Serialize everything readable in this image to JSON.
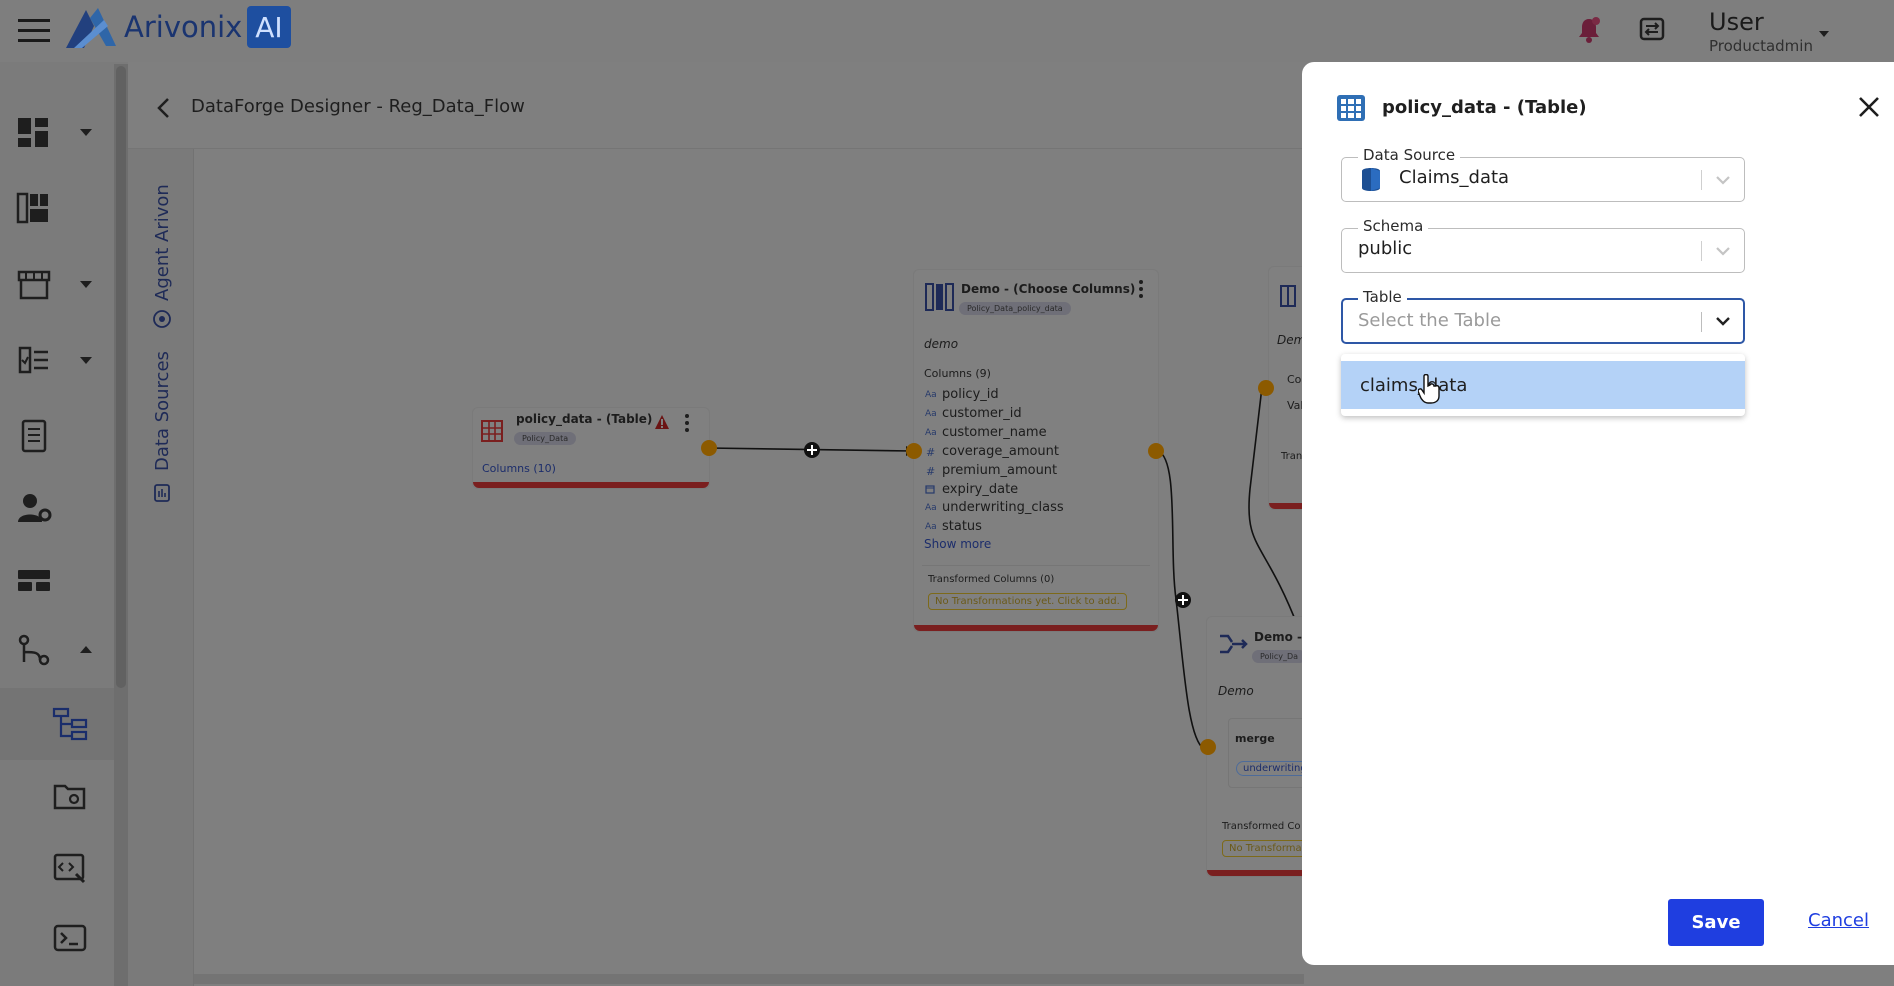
{
  "app": {
    "brand_name": "Arivonix",
    "brand_badge": "AI",
    "user_name": "User",
    "user_role": "Productadmin"
  },
  "page": {
    "title": "DataForge Designer - Reg_Data_Flow",
    "side_tabs": [
      "Agent Arivon",
      "Data Sources"
    ]
  },
  "canvas": {
    "node1": {
      "title": "policy_data - (Table)",
      "pill": "Policy_Data",
      "columns_label": "Columns (10)"
    },
    "node2": {
      "title": "Demo - (Choose Columns)",
      "pill": "Policy_Data_policy_data",
      "description": "demo",
      "columns_label": "Columns (9)",
      "columns": [
        {
          "type": "Aa",
          "name": "policy_id"
        },
        {
          "type": "Aa",
          "name": "customer_id"
        },
        {
          "type": "Aa",
          "name": "customer_name"
        },
        {
          "type": "#",
          "name": "coverage_amount"
        },
        {
          "type": "#",
          "name": "premium_amount"
        },
        {
          "type": "cal",
          "name": "expiry_date"
        },
        {
          "type": "Aa",
          "name": "underwriting_class"
        },
        {
          "type": "Aa",
          "name": "status"
        }
      ],
      "show_more": "Show more",
      "transformed_label": "Transformed Columns (0)",
      "transformed_empty": "No Transformations yet. Click to add."
    },
    "node3": {
      "title": "Demo - (",
      "pill": "Policy_Da",
      "description": "Demo",
      "merge_label": "merge",
      "merge_chip": "underwriting",
      "transformed_label": "Transformed Co",
      "transformed_empty": "No Transformati"
    },
    "node4": {
      "description": "Dem",
      "row1": "Co",
      "row2": "Val",
      "row3": "Tran"
    }
  },
  "panel": {
    "title": "policy_data - (Table)",
    "data_source": {
      "label": "Data Source",
      "value": "Claims_data"
    },
    "schema": {
      "label": "Schema",
      "value": "public"
    },
    "table": {
      "label": "Table",
      "placeholder": "Select the Table"
    },
    "options": [
      "claims_data"
    ],
    "save_label": "Save",
    "cancel_label": "Cancel"
  },
  "colors": {
    "primary": "#1f3ee0",
    "focus": "#2e57a6",
    "option_highlight": "#b4d2f7",
    "error_bar": "#b3262b"
  }
}
